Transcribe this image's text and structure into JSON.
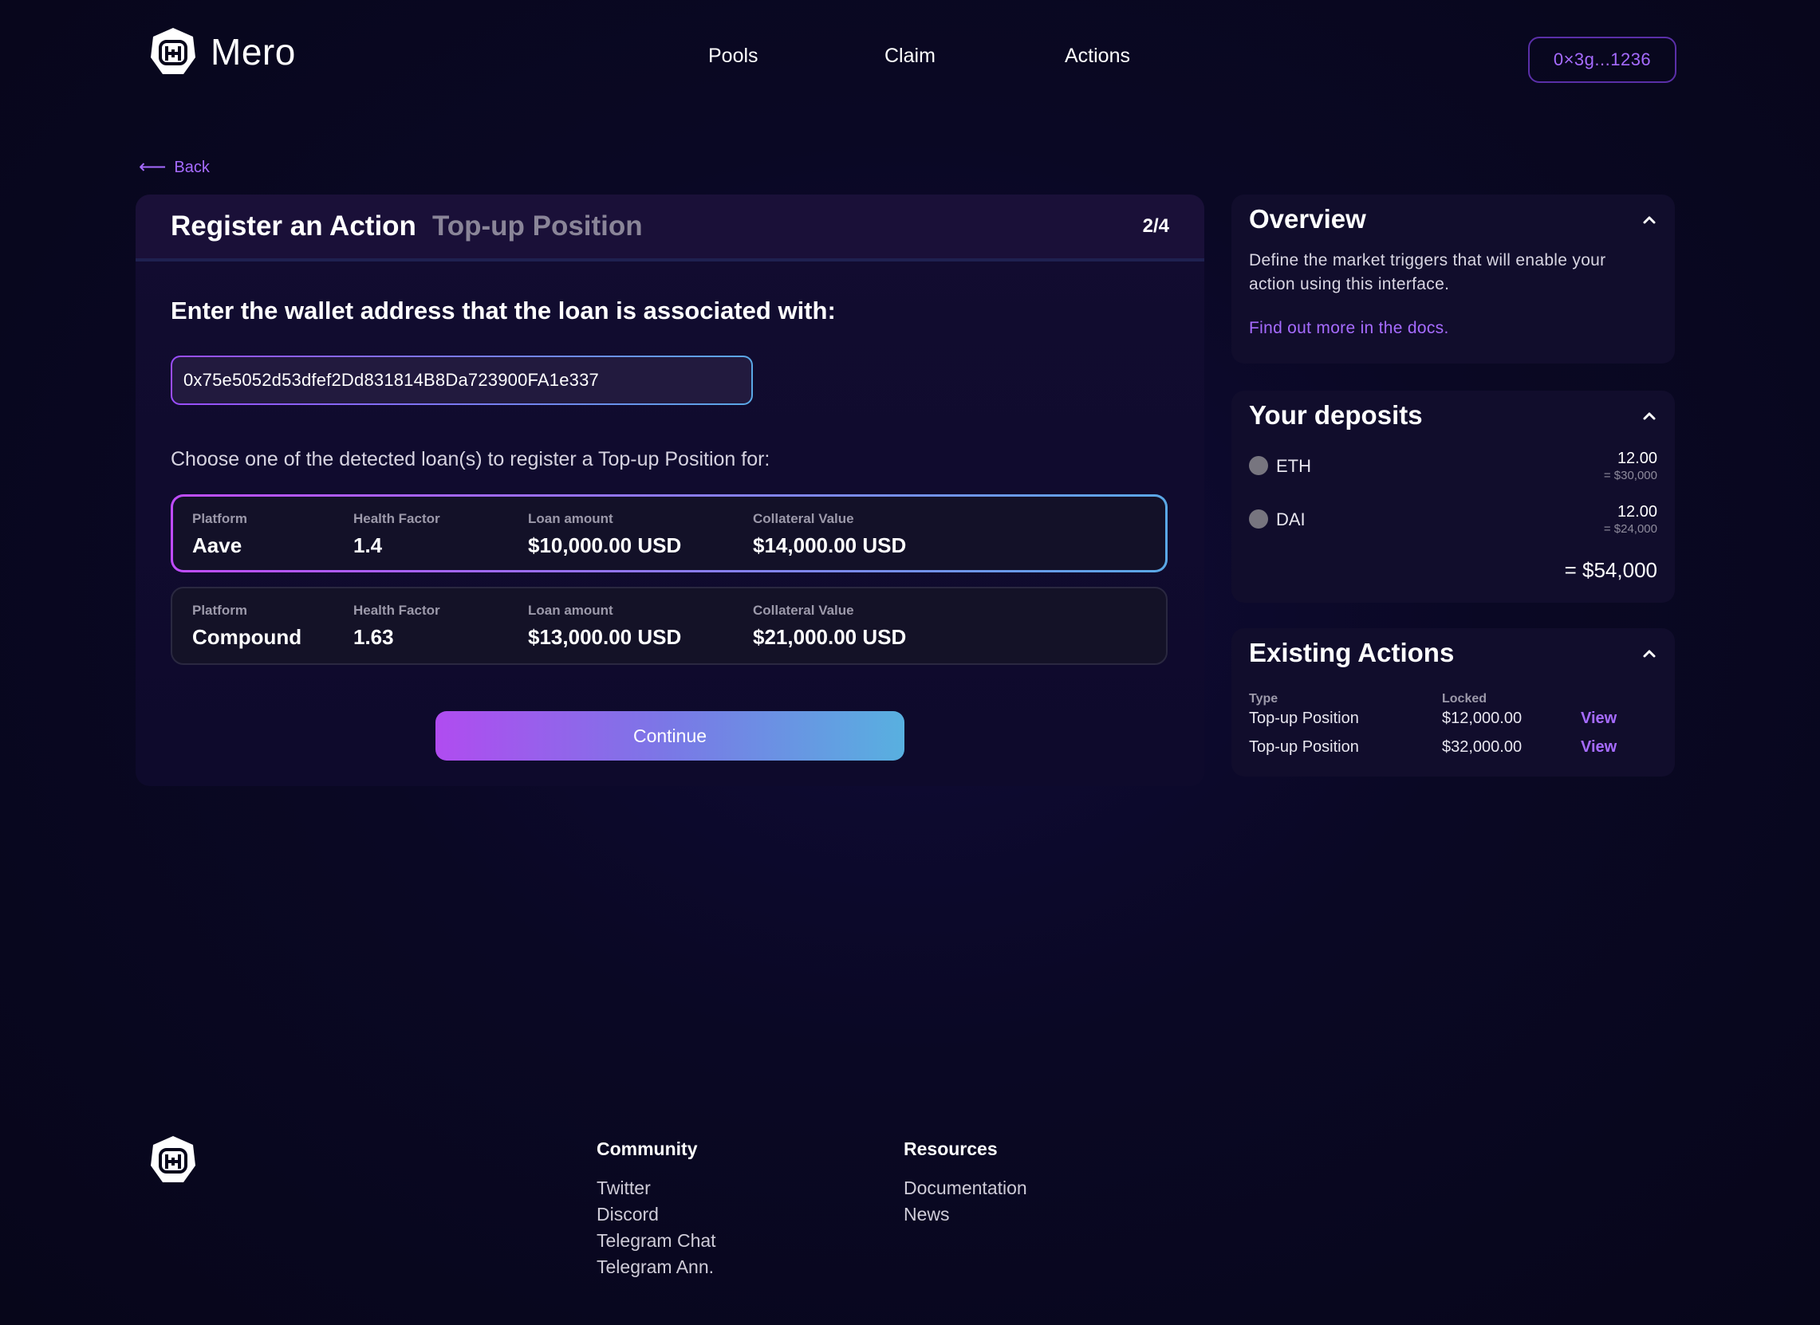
{
  "header": {
    "brand": "Mero",
    "nav": [
      "Pools",
      "Claim",
      "Actions"
    ],
    "wallet": "0×3g...1236"
  },
  "back_label": "Back",
  "register": {
    "title": "Register an Action",
    "subtitle": "Top-up Position",
    "step": "2/4",
    "question": "Enter the wallet address that the loan is associated with:",
    "address_value": "0x75e5052d53dfef2Dd831814B8Da723900FA1e337",
    "choose_text": "Choose one of the detected loan(s) to register a Top-up Position for:",
    "labels": {
      "platform": "Platform",
      "health": "Health Factor",
      "loan": "Loan amount",
      "collateral": "Collateral Value"
    },
    "loans": [
      {
        "platform": "Aave",
        "health": "1.4",
        "loan": "$10,000.00 USD",
        "collateral": "$14,000.00 USD",
        "selected": true
      },
      {
        "platform": "Compound",
        "health": "1.63",
        "loan": "$13,000.00 USD",
        "collateral": "$21,000.00 USD",
        "selected": false
      }
    ],
    "continue_label": "Continue"
  },
  "overview": {
    "title": "Overview",
    "text": "Define the market triggers that will enable your action using this interface.",
    "link": "Find out more in the docs."
  },
  "deposits": {
    "title": "Your deposits",
    "items": [
      {
        "token": "ETH",
        "amount": "12.00",
        "usd": "= $30,000"
      },
      {
        "token": "DAI",
        "amount": "12.00",
        "usd": "= $24,000"
      }
    ],
    "total": "= $54,000"
  },
  "existing_actions": {
    "title": "Existing Actions",
    "col_type": "Type",
    "col_locked": "Locked",
    "rows": [
      {
        "type": "Top-up Position",
        "locked": "$12,000.00",
        "view": "View"
      },
      {
        "type": "Top-up Position",
        "locked": "$32,000.00",
        "view": "View"
      }
    ]
  },
  "footer": {
    "community": {
      "title": "Community",
      "links": [
        "Twitter",
        "Discord",
        "Telegram Chat",
        "Telegram Ann."
      ]
    },
    "resources": {
      "title": "Resources",
      "links": [
        "Documentation",
        "News"
      ]
    }
  },
  "colors": {
    "accent": "#a66bff",
    "background": "#0a0824",
    "gradient_start": "#b04cf0",
    "gradient_end": "#58b0e0"
  }
}
